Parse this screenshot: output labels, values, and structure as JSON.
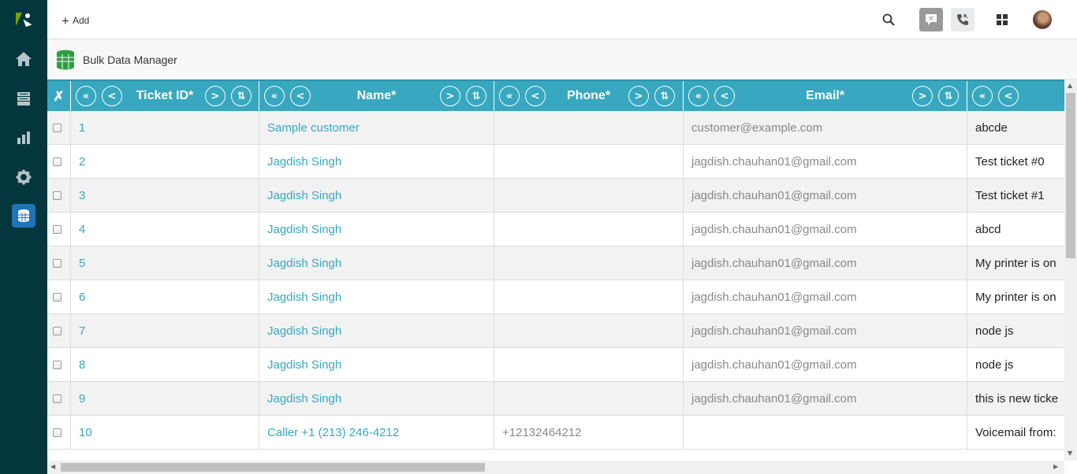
{
  "topbar": {
    "add_label": "Add"
  },
  "app": {
    "title": "Bulk Data Manager"
  },
  "icons": {
    "logo": "zendesk-logo",
    "home": "home-icon",
    "views": "views-icon",
    "reporting": "reporting-icon",
    "admin": "gear-icon",
    "app": "database-icon",
    "search": "search-icon",
    "chat": "chat-icon",
    "talk": "phone-icon",
    "products": "grid-icon"
  },
  "colors": {
    "sidebar": "#03363d",
    "header": "#37a8c0",
    "link": "#37a8c0",
    "accent": "#1f73b7"
  },
  "table": {
    "clear_mark": "✗",
    "controls": {
      "first": "«",
      "prev": "<",
      "next": ">",
      "sort": "⇅"
    },
    "columns": [
      "Ticket ID*",
      "Name*",
      "Phone*",
      "Email*",
      ""
    ],
    "rows": [
      {
        "id": "1",
        "name": "Sample customer",
        "phone": "",
        "email": "customer@example.com",
        "subject": "abcde"
      },
      {
        "id": "2",
        "name": "Jagdish Singh",
        "phone": "",
        "email": "jagdish.chauhan01@gmail.com",
        "subject": "Test ticket #0"
      },
      {
        "id": "3",
        "name": "Jagdish Singh",
        "phone": "",
        "email": "jagdish.chauhan01@gmail.com",
        "subject": "Test ticket #1"
      },
      {
        "id": "4",
        "name": "Jagdish Singh",
        "phone": "",
        "email": "jagdish.chauhan01@gmail.com",
        "subject": "abcd"
      },
      {
        "id": "5",
        "name": "Jagdish Singh",
        "phone": "",
        "email": "jagdish.chauhan01@gmail.com",
        "subject": "My printer is on"
      },
      {
        "id": "6",
        "name": "Jagdish Singh",
        "phone": "",
        "email": "jagdish.chauhan01@gmail.com",
        "subject": "My printer is on"
      },
      {
        "id": "7",
        "name": "Jagdish Singh",
        "phone": "",
        "email": "jagdish.chauhan01@gmail.com",
        "subject": "node js"
      },
      {
        "id": "8",
        "name": "Jagdish Singh",
        "phone": "",
        "email": "jagdish.chauhan01@gmail.com",
        "subject": "node js"
      },
      {
        "id": "9",
        "name": "Jagdish Singh",
        "phone": "",
        "email": "jagdish.chauhan01@gmail.com",
        "subject": "this is new ticke"
      },
      {
        "id": "10",
        "name": "Caller +1 (213) 246-4212",
        "phone": "+12132464212",
        "email": "",
        "subject": "Voicemail from:"
      }
    ]
  }
}
